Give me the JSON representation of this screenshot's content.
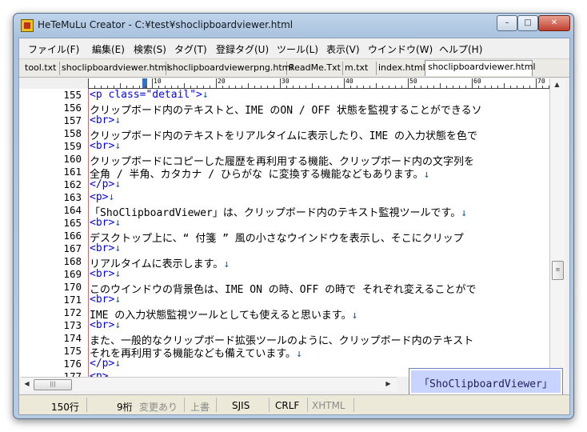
{
  "window": {
    "title": "HeTeMuLu Creator - C:¥test¥shoclipboardviewer.html",
    "minimize": "–",
    "maximize": "□",
    "close": "✕"
  },
  "menu": [
    "ファイル(F)",
    "編集(E)",
    "検索(S)",
    "タグ(T)",
    "登録タグ(U)",
    "ツール(L)",
    "表示(V)",
    "ウインドウ(W)",
    "ヘルプ(H)"
  ],
  "tabs": [
    "tool.txt",
    "shoclipboardviewer.html",
    "shoclipboardviewerpng.html",
    "ReadMe.Txt",
    "m.txt",
    "index.html",
    "shoclipboardviewer.html"
  ],
  "active_tab_index": 6,
  "ruler": {
    "marks": [
      "10",
      "20",
      "30",
      "40",
      "50",
      "60",
      "70"
    ]
  },
  "gutter": [
    "155",
    "156",
    "157",
    "158",
    "159",
    "160",
    "161",
    "162",
    "163",
    "164",
    "165",
    "166",
    "167",
    "168",
    "169",
    "170",
    "171",
    "172",
    "173",
    "174",
    "175",
    "176",
    "177"
  ],
  "lines": [
    {
      "tag": "<p class=\"detail\">",
      "text": "",
      "eol": "↓"
    },
    {
      "tag": "",
      "text": "クリップボード内のテキストと、IME のON / OFF 状態を監視することができるソ",
      "eol": ""
    },
    {
      "tag": "<br>",
      "text": "",
      "eol": "↓"
    },
    {
      "tag": "",
      "text": "クリップボード内のテキストをリアルタイムに表示したり、IME の入力状態を色で",
      "eol": ""
    },
    {
      "tag": "<br>",
      "text": "",
      "eol": "↓"
    },
    {
      "tag": "",
      "text": "クリップボードにコピーした履歴を再利用する機能、クリップボード内の文字列を",
      "eol": ""
    },
    {
      "tag": "",
      "text": "全角 / 半角、カタカナ / ひらがな に変換する機能などもあります。",
      "eol": "↓"
    },
    {
      "tag": "</p>",
      "text": "",
      "eol": "↓"
    },
    {
      "tag": "<p>",
      "text": "",
      "eol": "↓"
    },
    {
      "tag": "",
      "text": "「ShoClipboardViewer」は、クリップボード内のテキスト監視ツールです。",
      "eol": "↓"
    },
    {
      "tag": "<br>",
      "text": "",
      "eol": "↓"
    },
    {
      "tag": "",
      "text": "デスクトップ上に、“ 付箋 ” 風の小さなウインドウを表示し、そこにクリップ",
      "eol": ""
    },
    {
      "tag": "<br>",
      "text": "",
      "eol": "↓"
    },
    {
      "tag": "",
      "text": "リアルタイムに表示します。",
      "eol": "↓"
    },
    {
      "tag": "<br>",
      "text": "",
      "eol": "↓"
    },
    {
      "tag": "",
      "text": "このウインドウの背景色は、IME ON の時、OFF の時で それぞれ変えることがで",
      "eol": ""
    },
    {
      "tag": "<br>",
      "text": "",
      "eol": "↓"
    },
    {
      "tag": "",
      "text": "IME の入力状態監視ツールとしても使えると思います。",
      "eol": "↓"
    },
    {
      "tag": "<br>",
      "text": "",
      "eol": "↓"
    },
    {
      "tag": "",
      "text": "また、一般的なクリップボード拡張ツールのように、クリップボード内のテキスト",
      "eol": ""
    },
    {
      "tag": "",
      "text": "それを再利用する機能なども備えています。",
      "eol": "↓"
    },
    {
      "tag": "</p>",
      "text": "",
      "eol": "↓"
    },
    {
      "tag": "<p>",
      "text": "",
      "eol": ""
    }
  ],
  "popup": {
    "text": "「ShoClipboardViewer」"
  },
  "status": {
    "line": "150行",
    "column": "9桁",
    "modified": "変更あり",
    "overwrite": "上書",
    "encoding": "SJIS",
    "newline": "CRLF",
    "mode": "XHTML"
  },
  "colors": {
    "tag": "#0000ff",
    "eol": "#1e5aa8",
    "popup_bg": "#c8d4ff"
  },
  "icons": {
    "app": "app-icon",
    "scroll_up": "arrow-up-icon",
    "scroll_down": "arrow-down-icon",
    "scroll_left": "arrow-left-icon",
    "scroll_right": "arrow-right-icon"
  }
}
